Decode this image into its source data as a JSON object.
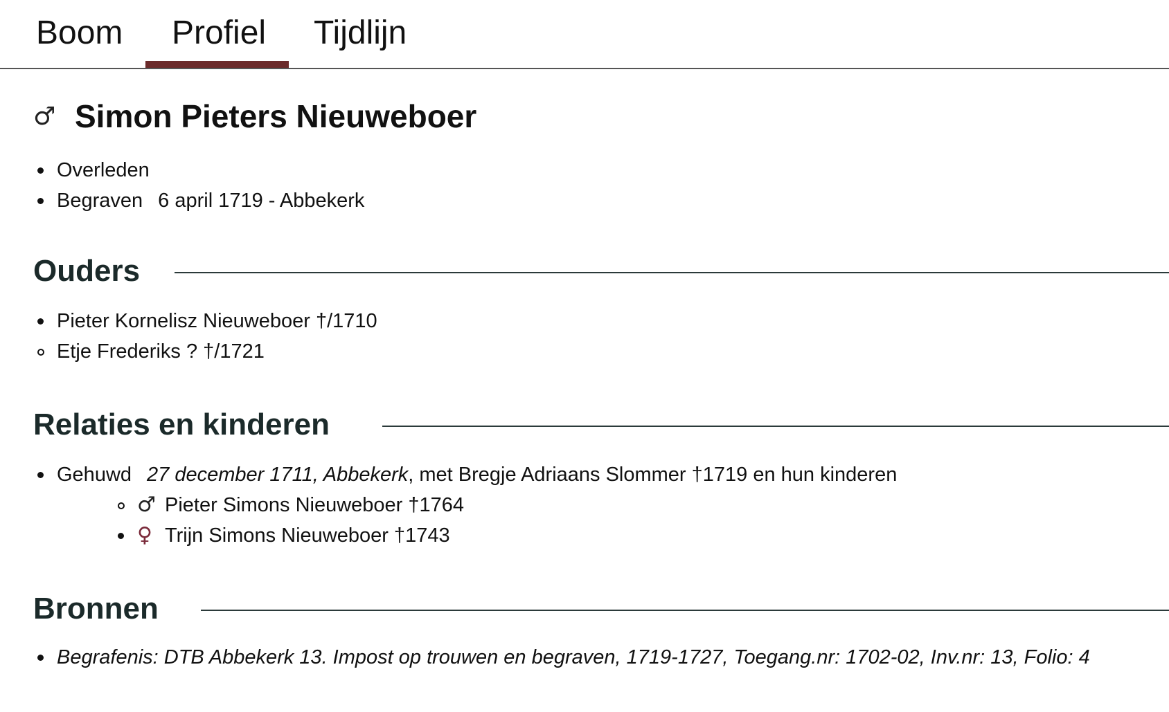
{
  "tabs": [
    {
      "label": "Boom",
      "active": false
    },
    {
      "label": "Profiel",
      "active": true
    },
    {
      "label": "Tijdlijn",
      "active": false
    }
  ],
  "accent_color": "#6b2a2a",
  "person": {
    "sex_icon": "male-icon",
    "sex_glyph": "♂",
    "name": "Simon Pieters Nieuweboer"
  },
  "facts": [
    {
      "label": "Overleden",
      "value": ""
    },
    {
      "label": "Begraven",
      "value": "6 april 1719 - Abbekerk"
    }
  ],
  "sections": {
    "ouders": "Ouders",
    "relaties": "Relaties en kinderen",
    "bronnen": "Bronnen"
  },
  "parents": [
    {
      "text": "Pieter Kornelisz Nieuweboer †/1710",
      "bullet": "filled"
    },
    {
      "text": "Etje Frederiks ? †/1721",
      "bullet": "hollow"
    }
  ],
  "relation": {
    "type": "Gehuwd",
    "date_place": "27 december 1711, Abbekerk",
    "text": ", met Bregje Adriaans Slommer †1719 en hun kinderen"
  },
  "children": [
    {
      "glyph": "♂",
      "icon": "male-icon",
      "text": "Pieter Simons Nieuweboer †1764",
      "bullet": "hollow"
    },
    {
      "glyph": "♀",
      "icon": "female-icon",
      "text": "Trijn Simons Nieuweboer †1743",
      "bullet": "filled"
    }
  ],
  "sources": [
    "Begrafenis: DTB Abbekerk 13. Impost op trouwen en begraven, 1719-1727, Toegang.nr: 1702-02, Inv.nr: 13, Folio: 4"
  ]
}
